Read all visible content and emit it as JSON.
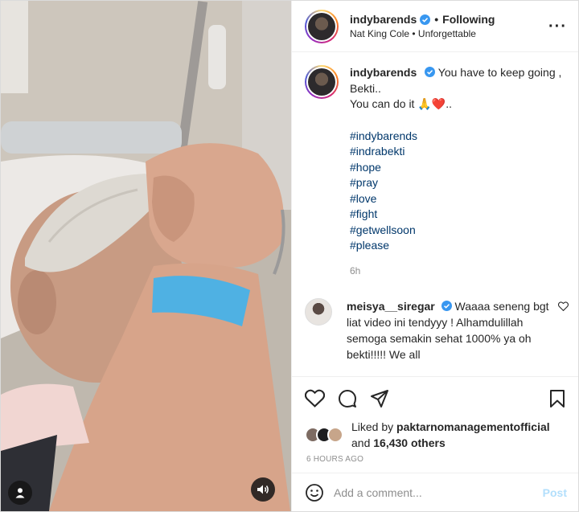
{
  "post": {
    "author": "indybarends",
    "follow_status": "Following",
    "separator": "•",
    "audio": "Nat King Cole • Unforgettable",
    "more_icon": "more-horizontal-icon"
  },
  "caption": {
    "author": "indybarends",
    "text_line1": "You have to keep going , Bekti..",
    "text_line2": "You can do it 🙏❤️..",
    "hashtags": [
      "#indybarends",
      "#indrabekti",
      "#hope",
      "#pray",
      "#love",
      "#fight",
      "#getwellsoon",
      "#please"
    ],
    "age": "6h"
  },
  "comments": [
    {
      "author": "meisya__siregar",
      "text": "Waaaa seneng bgt liat video ini tendyyy ! Alhamdulillah semoga semakin sehat 1000% ya oh bekti!!!!! We all"
    }
  ],
  "likes": {
    "prefix": "Liked by",
    "liked_by": "paktarnomanagementofficial",
    "middle": "and",
    "others": "16,430 others"
  },
  "timestamp": "6 HOURS AGO",
  "composer": {
    "placeholder": "Add a comment...",
    "post_label": "Post"
  },
  "colors": {
    "verified": "#3897f0",
    "hashtag": "#00376b",
    "post_button_disabled": "#b2dffc",
    "muted": "#8e8e8e"
  }
}
